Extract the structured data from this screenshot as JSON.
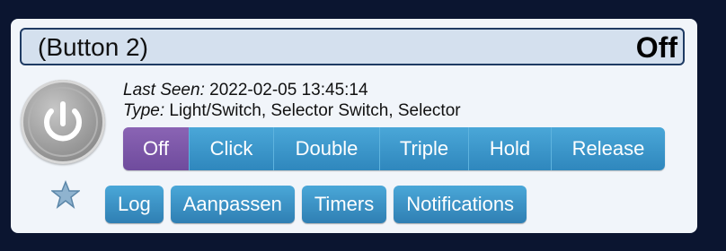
{
  "device": {
    "name": "(Button 2)",
    "state": "Off",
    "last_seen_label": "Last Seen:",
    "last_seen_value": "2022-02-05 13:45:14",
    "type_label": "Type:",
    "type_value": "Light/Switch, Selector Switch, Selector",
    "icon": "power-icon"
  },
  "selector": {
    "options": [
      "Off",
      "Click",
      "Double",
      "Triple",
      "Hold",
      "Release"
    ],
    "active": "Off",
    "active_color": "#7b57a8",
    "button_color": "#3d97cc"
  },
  "actions": {
    "favorite_icon": "star-icon",
    "buttons": [
      "Log",
      "Aanpassen",
      "Timers",
      "Notifications"
    ]
  }
}
